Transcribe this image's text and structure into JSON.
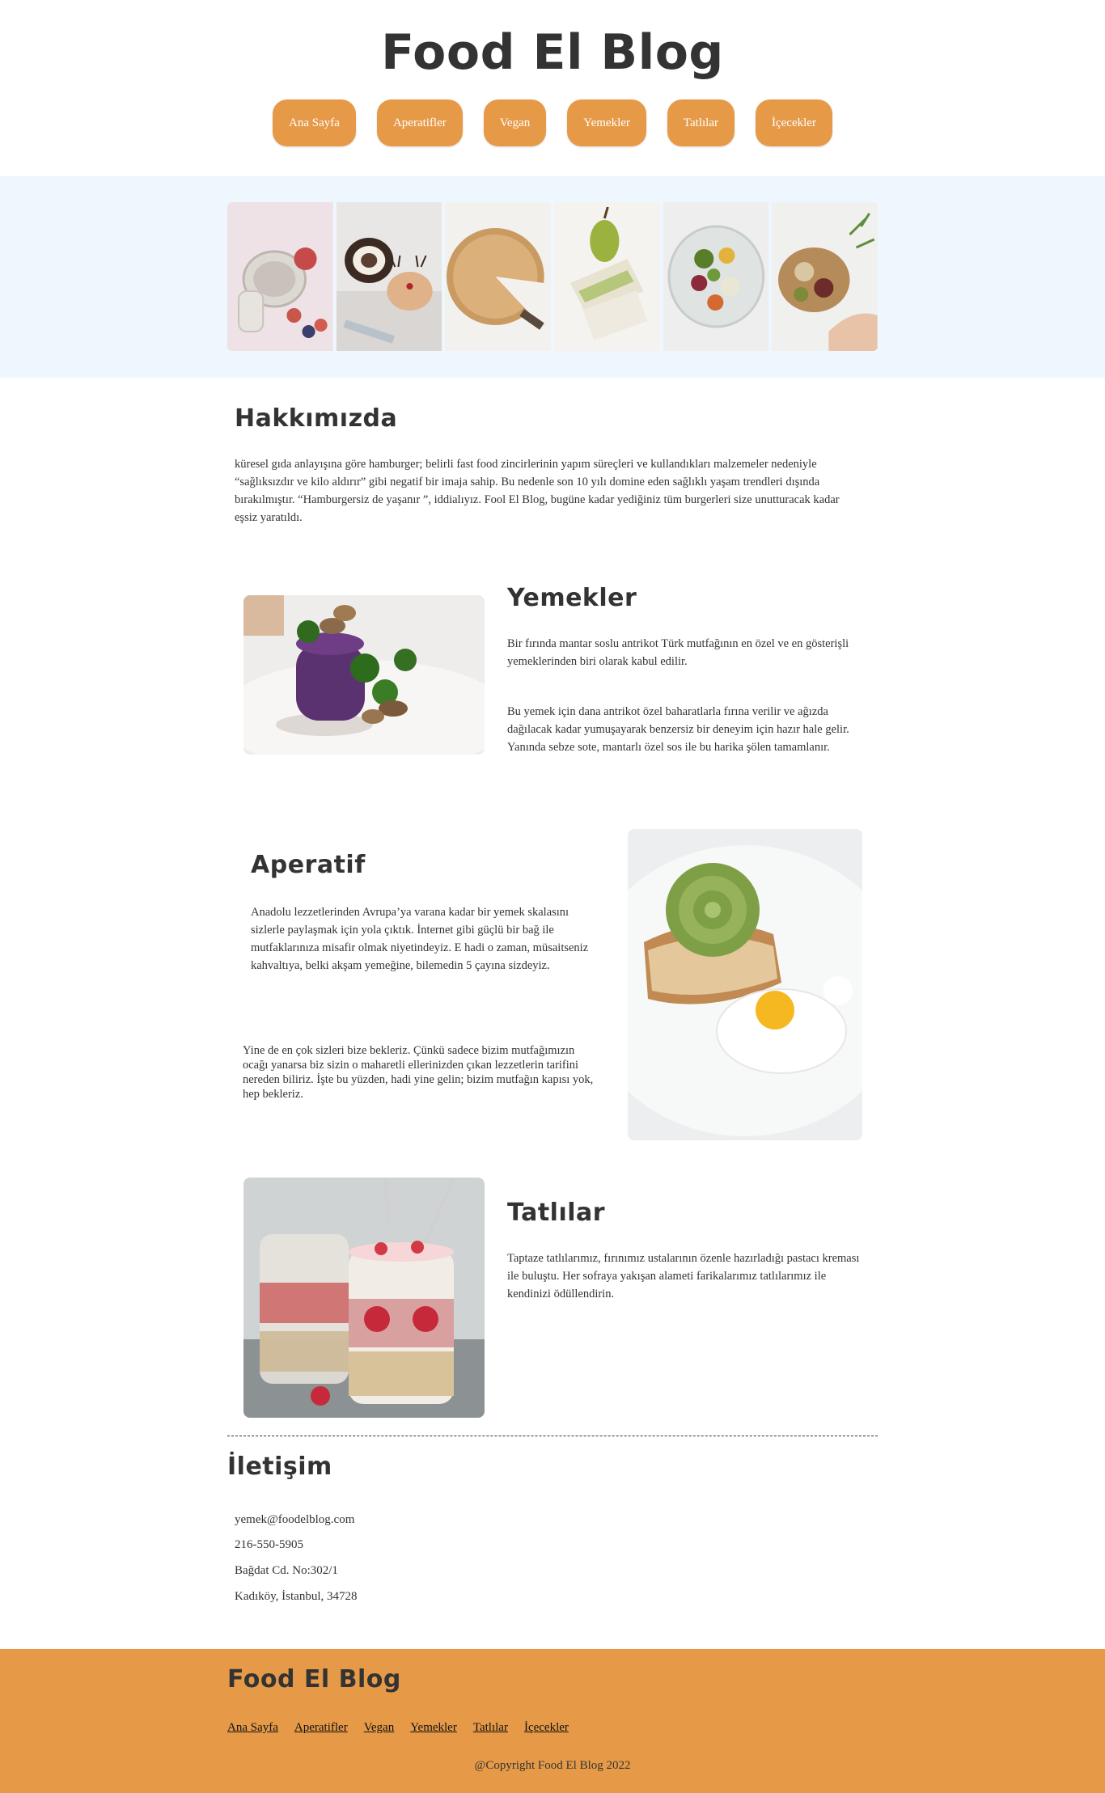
{
  "header": {
    "title": "Food El Blog",
    "nav": [
      "Ana Sayfa",
      "Aperatifler",
      "Vegan",
      "Yemekler",
      "Tatlılar",
      "İçecekler"
    ]
  },
  "colors": {
    "accent": "#e69a48",
    "banner_bg": "#eef6fe",
    "text": "#333333"
  },
  "about": {
    "heading": "Hakkımızda",
    "text": "küresel gıda anlayışına göre hamburger; belirli fast food zincirlerinin yapım süreçleri ve kullandıkları malzemeler nedeniyle “sağlıksızdır ve kilo aldırır” gibi negatif bir imaja sahip. Bu nedenle son 10 yılı domine eden sağlıklı yaşam trendleri dışında bırakılmıştır. “Hamburgersiz de yaşanır ”, iddialıyız. Fool El Blog, bugüne kadar yediğiniz tüm burgerleri size unutturacak kadar eşsiz yaratıldı."
  },
  "yemekler": {
    "heading": "Yemekler",
    "p1": "Bir fırında mantar soslu antrikot Türk mutfağının en özel ve en gösterişli yemeklerinden biri olarak kabul edilir.",
    "p2": "Bu yemek için dana antrikot özel baharatlarla fırına verilir ve ağızda dağılacak kadar yumuşayarak benzersiz bir deneyim için hazır hale gelir. Yanında sebze sote, mantarlı özel sos ile bu harika şölen tamamlanır."
  },
  "aperatif": {
    "heading": "Aperatif",
    "p1": "Anadolu lezzetlerinden Avrupa’ya varana kadar bir yemek skalasını sizlerle paylaşmak için yola çıktık. İnternet gibi güçlü bir bağ ile mutfaklarınıza misafir olmak niyetindeyiz. E hadi o zaman, müsaitseniz kahvaltıya, belki akşam yemeğine, bilemedin 5 çayına sizdeyiz.",
    "p2": "Yine de en çok sizleri bize bekleriz. Çünkü sadece bizim mutfağımızın ocağı yanarsa biz sizin o maharetli ellerinizden çıkan lezzetlerin tarifini nereden biliriz. İşte bu yüzden, hadi yine gelin; bizim mutfağın kapısı yok, hep bekleriz."
  },
  "tatlilar": {
    "heading": "Tatlılar",
    "p1": "Taptaze tatlılarımız, fırınımız ustalarının özenle hazırladığı pastacı kreması ile buluştu. Her sofraya yakışan alameti farikalarımız tatlılarımız ile kendinizi ödüllendirin."
  },
  "contact": {
    "heading": "İletişim",
    "email": "yemek@foodelblog.com",
    "phone": "216-550-5905",
    "address1": "Bağdat Cd. No:302/1",
    "address2": "Kadıköy, İstanbul, 34728"
  },
  "footer": {
    "title": "Food El Blog",
    "links": [
      "Ana Sayfa",
      "Aperatifler",
      "Vegan",
      "Yemekler",
      "Tatlılar",
      "İçecekler"
    ],
    "copyright": "@Copyright Food El Blog 2022"
  }
}
